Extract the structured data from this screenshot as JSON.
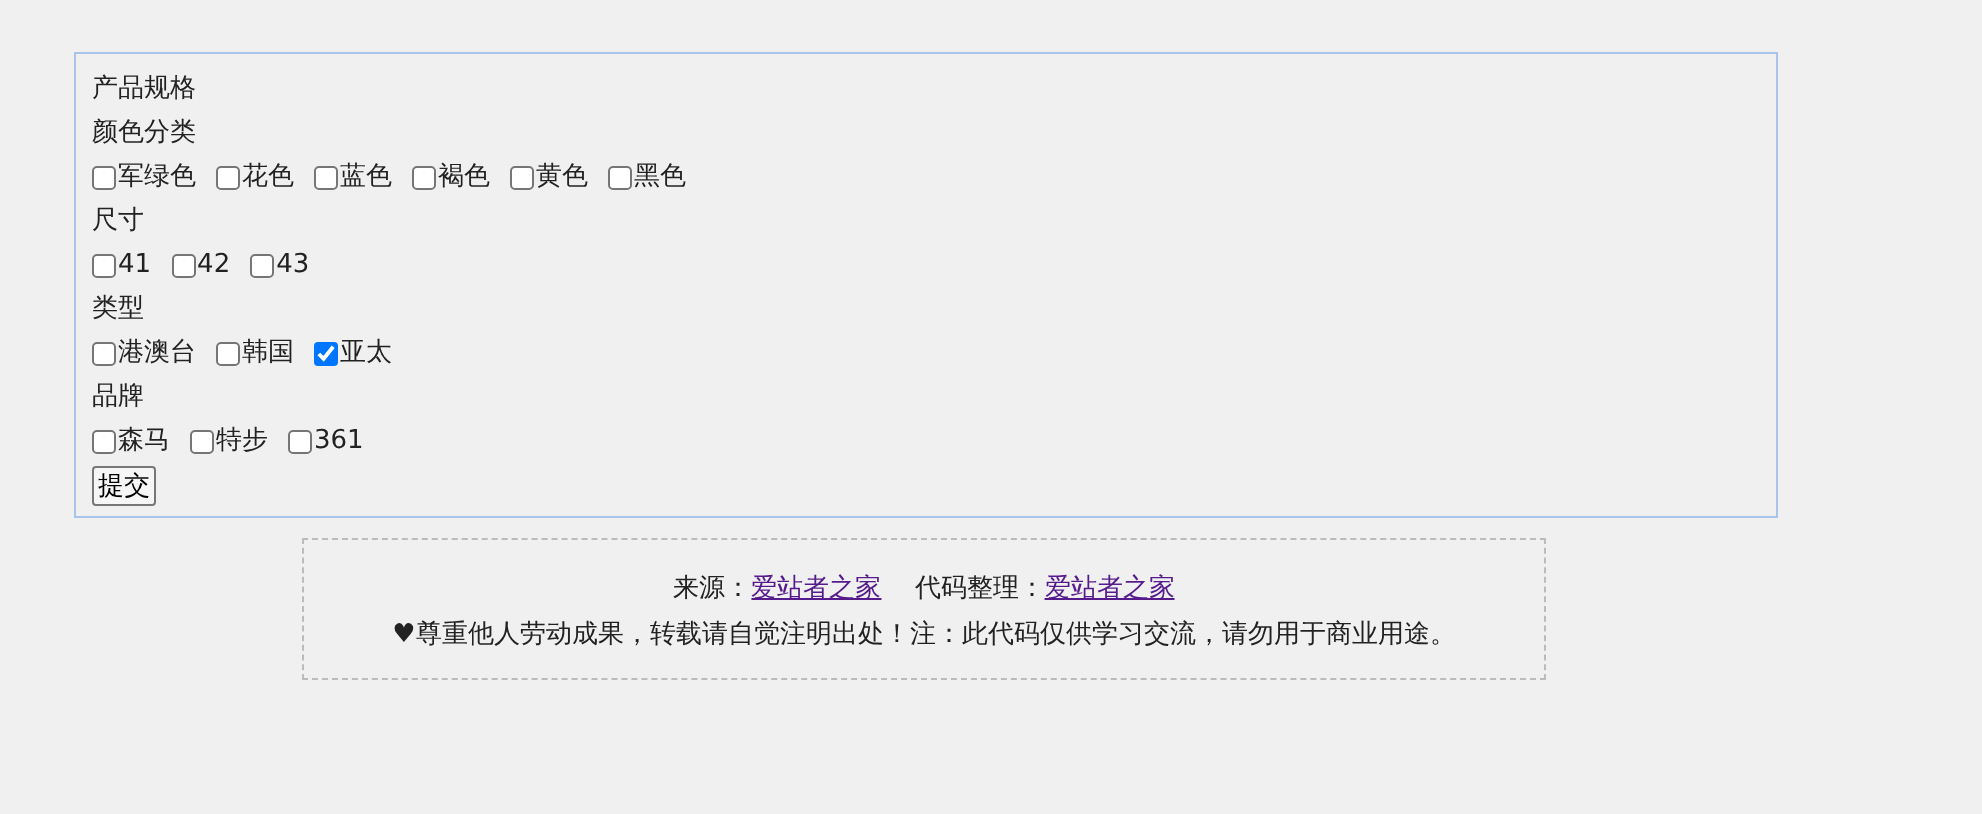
{
  "form": {
    "title": "产品规格",
    "groups": [
      {
        "label": "颜色分类",
        "options": [
          {
            "label": "军绿色",
            "checked": false
          },
          {
            "label": "花色",
            "checked": false
          },
          {
            "label": "蓝色",
            "checked": false
          },
          {
            "label": "褐色",
            "checked": false
          },
          {
            "label": "黄色",
            "checked": false
          },
          {
            "label": "黑色",
            "checked": false
          }
        ]
      },
      {
        "label": "尺寸",
        "options": [
          {
            "label": "41",
            "checked": false
          },
          {
            "label": "42",
            "checked": false
          },
          {
            "label": "43",
            "checked": false
          }
        ]
      },
      {
        "label": "类型",
        "options": [
          {
            "label": "港澳台",
            "checked": false
          },
          {
            "label": "韩国",
            "checked": false
          },
          {
            "label": "亚太",
            "checked": true
          }
        ]
      },
      {
        "label": "品牌",
        "options": [
          {
            "label": "森马",
            "checked": false
          },
          {
            "label": "特步",
            "checked": false
          },
          {
            "label": "361",
            "checked": false
          }
        ]
      }
    ],
    "submit": "提交"
  },
  "footer": {
    "source_label": "来源：",
    "source_link": "爱站者之家",
    "organizer_label": "代码整理：",
    "organizer_link": "爱站者之家",
    "notice": "♥尊重他人劳动成果，转载请自觉注明出处！注：此代码仅供学习交流，请勿用于商业用途。"
  }
}
